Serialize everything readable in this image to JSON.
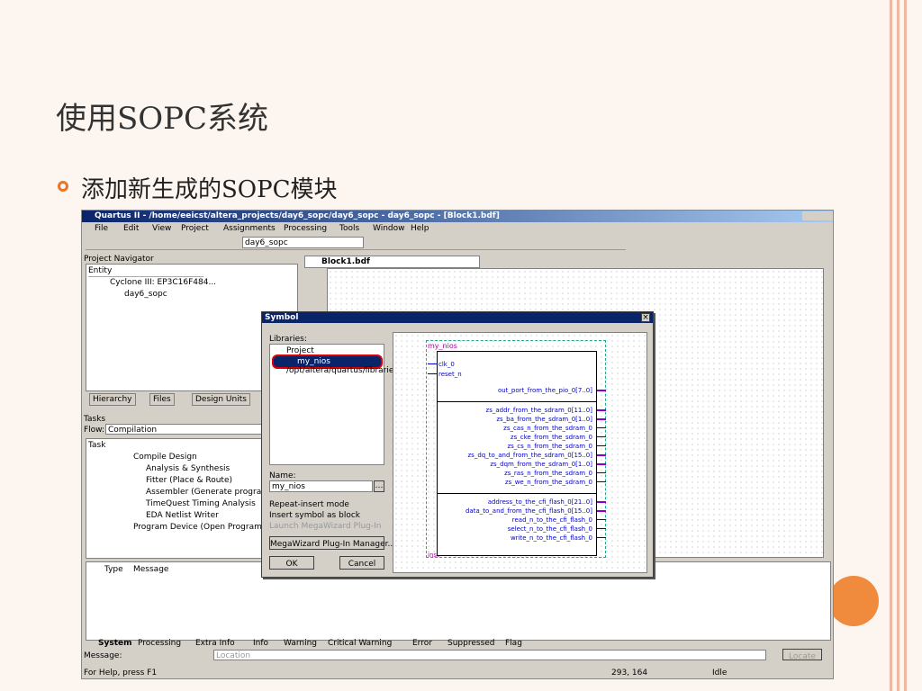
{
  "slide": {
    "title": "使用SOPC系统",
    "bullet": "添加新生成的SOPC模块"
  },
  "window": {
    "title": "Quartus II - /home/eeicst/altera_projects/day6_sopc/day6_sopc - day6_sopc - [Block1.bdf]",
    "menus": [
      "File",
      "Edit",
      "View",
      "Project",
      "Assignments",
      "Processing",
      "Tools",
      "Window",
      "Help"
    ],
    "project_combo": "day6_sopc"
  },
  "navigator": {
    "title": "Project Navigator",
    "col": "Entity",
    "device": "Cyclone III: EP3C16F484...",
    "entity": "day6_sopc",
    "tabs": [
      "Hierarchy",
      "Files",
      "Design Units"
    ]
  },
  "tasks": {
    "title": "Tasks",
    "flow_label": "Flow:",
    "flow": "Compilation",
    "header": "Task",
    "items": [
      "Compile Design",
      "Analysis & Synthesis",
      "Fitter (Place & Route)",
      "Assembler (Generate programm",
      "TimeQuest Timing Analysis",
      "EDA Netlist Writer",
      "Program Device (Open Programme"
    ]
  },
  "doc_tab": "Block1.bdf",
  "symbol": {
    "title": "Symbol",
    "libs_label": "Libraries:",
    "tree": [
      "Project",
      "my_nios",
      "/opt/altera/quartus/libraries/"
    ],
    "name_label": "Name:",
    "name": "my_nios",
    "opts": [
      "Repeat-insert mode",
      "Insert symbol as block",
      "Launch MegaWizard Plug-In"
    ],
    "mega": "MegaWizard Plug-In Manager...",
    "ok": "OK",
    "cancel": "Cancel",
    "block": {
      "name": "my_nios",
      "inputs": [
        "clk_0",
        "reset_n"
      ],
      "out1": [
        "out_port_from_the_pio_0[7..0]"
      ],
      "out2": [
        "zs_addr_from_the_sdram_0[11..0]",
        "zs_ba_from_the_sdram_0[1..0]",
        "zs_cas_n_from_the_sdram_0",
        "zs_cke_from_the_sdram_0",
        "zs_cs_n_from_the_sdram_0",
        "zs_dq_to_and_from_the_sdram_0[15..0]",
        "zs_dqm_from_the_sdram_0[1..0]",
        "zs_ras_n_from_the_sdram_0",
        "zs_we_n_from_the_sdram_0"
      ],
      "out3": [
        "address_to_the_cfi_flash_0[21..0]",
        "data_to_and_from_the_cfi_flash_0[15..0]",
        "read_n_to_the_cfi_flash_0",
        "select_n_to_the_cfi_flash_0",
        "write_n_to_the_cfi_flash_0"
      ],
      "inst": "inst"
    }
  },
  "messages": {
    "cols": [
      "Type",
      "Message"
    ],
    "tabs": [
      "System",
      "Processing",
      "Extra Info",
      "Info",
      "Warning",
      "Critical Warning",
      "Error",
      "Suppressed",
      "Flag"
    ],
    "msg_label": "Message:",
    "location_placeholder": "Location",
    "locate": "Locate"
  },
  "status": {
    "help": "For Help, press F1",
    "coords": "293, 164",
    "state": "Idle"
  }
}
